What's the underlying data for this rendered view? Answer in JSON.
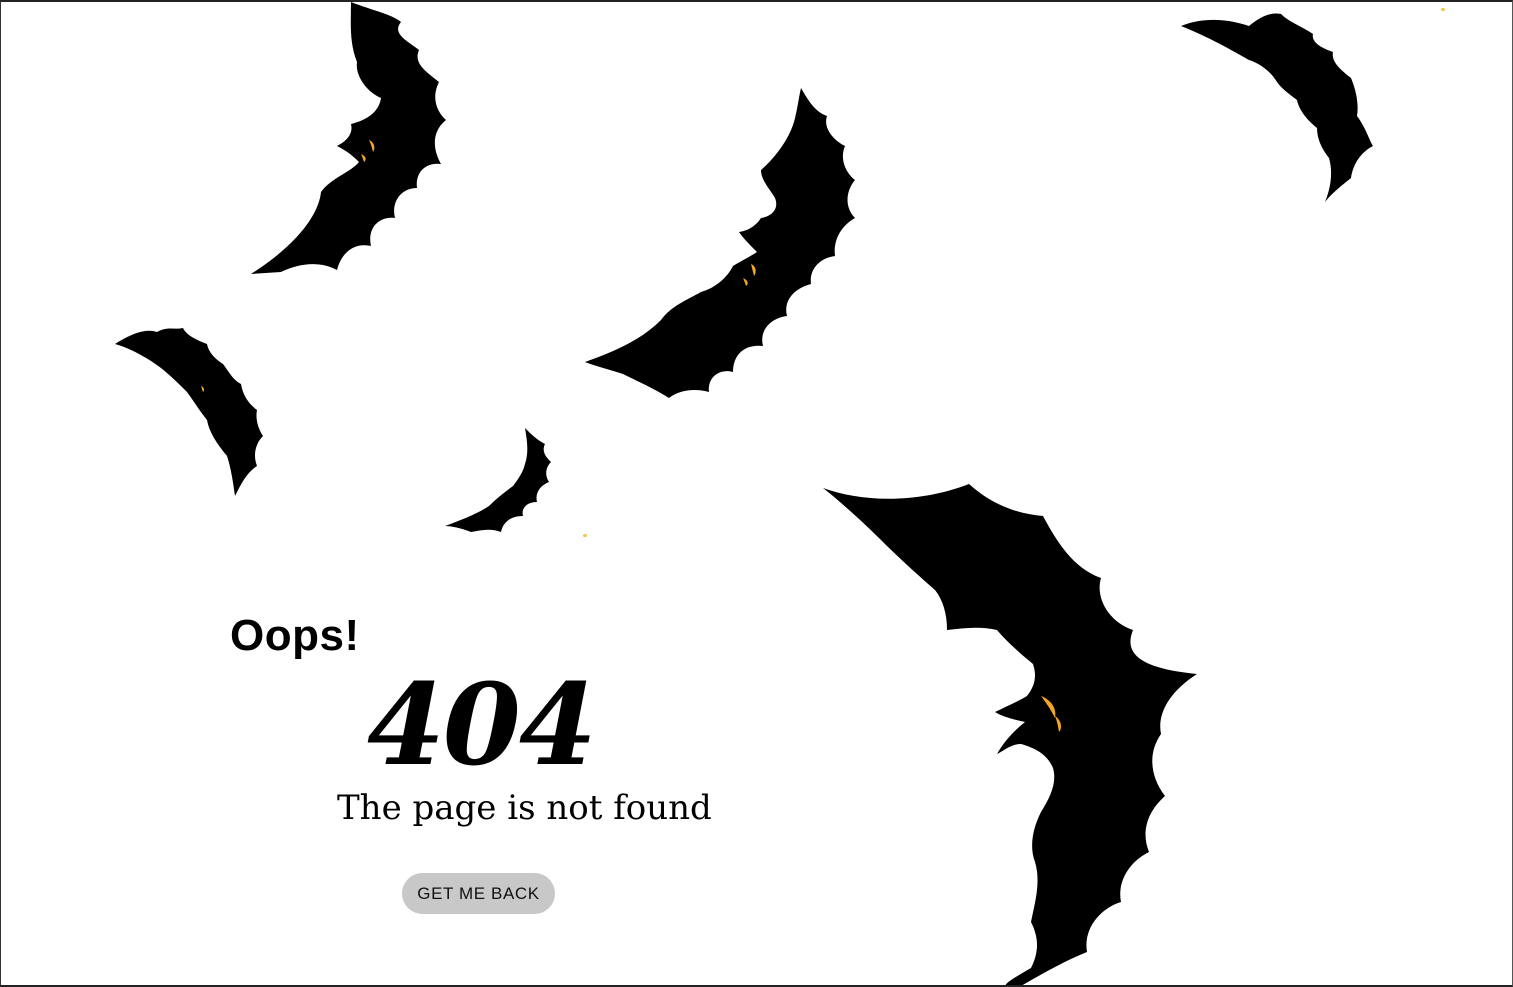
{
  "error": {
    "exclamation": "Oops!",
    "code": "404",
    "message": "The page is not found"
  },
  "actions": {
    "back_label": "GET ME BACK"
  },
  "decorations": {
    "icon": "bat-icon",
    "bat_color": "#000000",
    "eye_color": "#f5a623"
  },
  "colors": {
    "background": "#ffffff",
    "button_background": "#c8c8c8",
    "text": "#000000"
  }
}
